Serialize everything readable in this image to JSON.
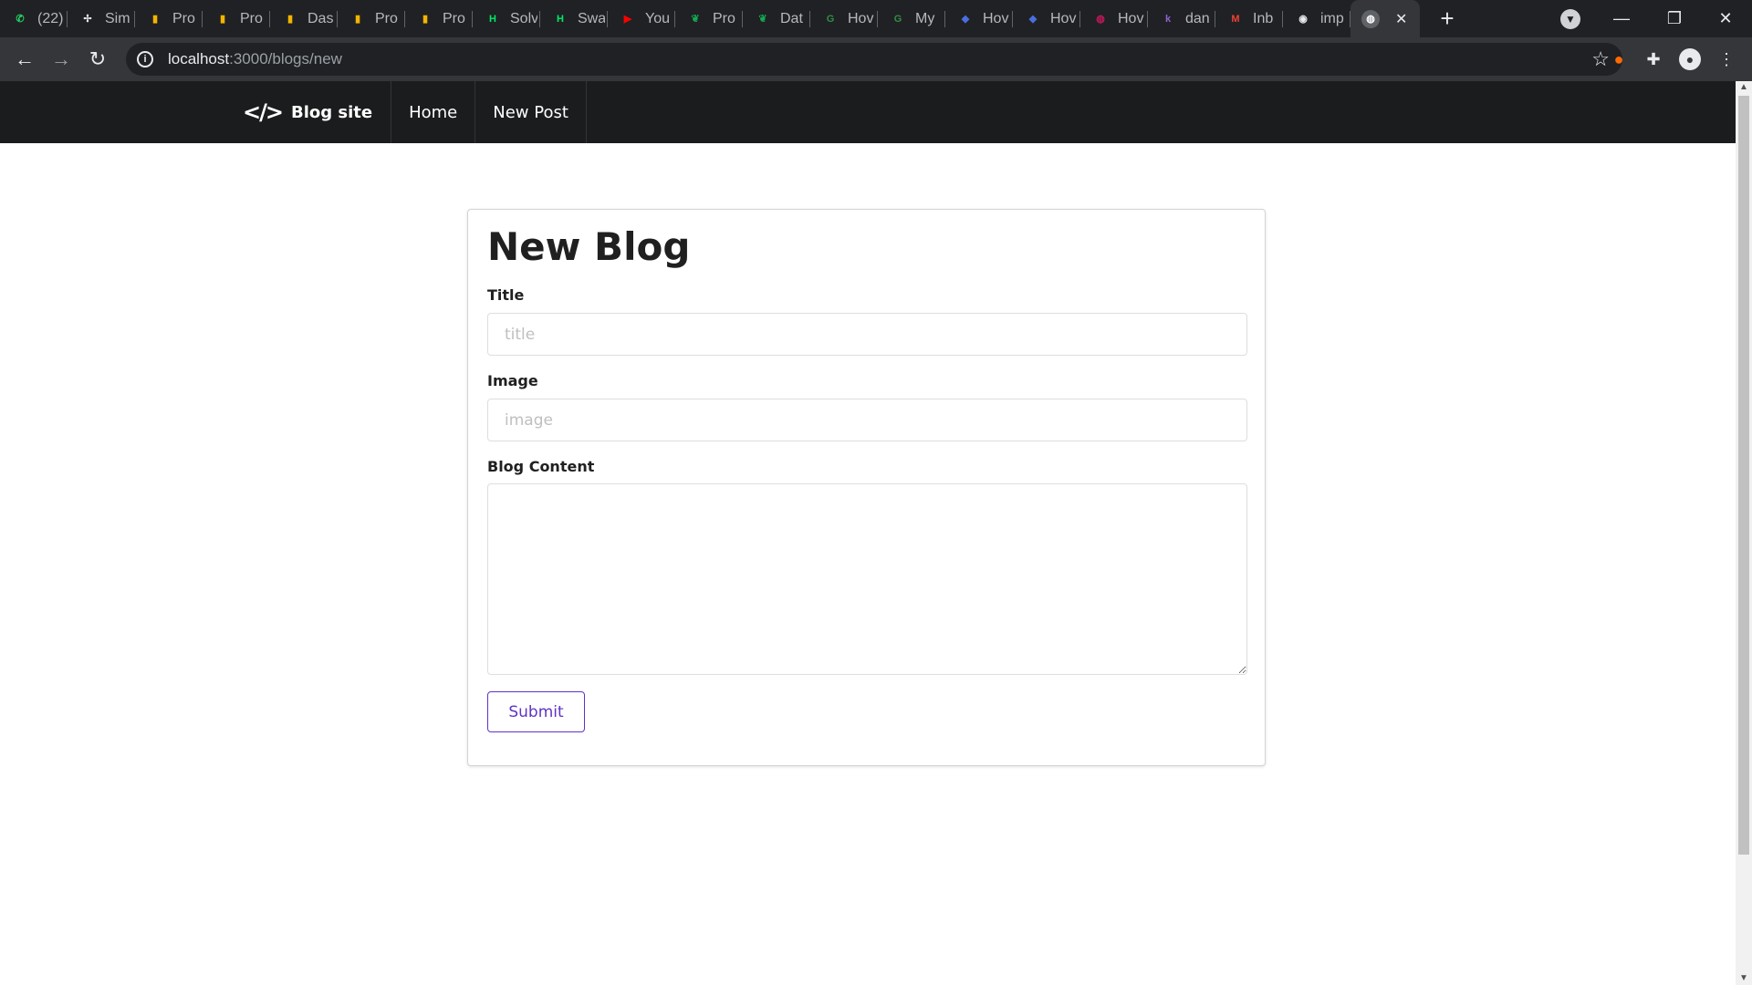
{
  "browser": {
    "tabs": [
      {
        "title": "(22)",
        "icon": "whatsapp-icon",
        "color": "#25d366"
      },
      {
        "title": "Sim",
        "icon": "pinwheel-icon",
        "color": "#e8eaed"
      },
      {
        "title": "Pro",
        "icon": "bar-chart-icon",
        "color": "#f4b400"
      },
      {
        "title": "Pro",
        "icon": "bar-chart-icon",
        "color": "#f4b400"
      },
      {
        "title": "Das",
        "icon": "bar-chart-icon",
        "color": "#f4b400"
      },
      {
        "title": "Pro",
        "icon": "bar-chart-icon",
        "color": "#f4b400"
      },
      {
        "title": "Pro",
        "icon": "bar-chart-icon",
        "color": "#f4b400"
      },
      {
        "title": "Solv",
        "icon": "hackerrank-icon",
        "color": "#00ea64"
      },
      {
        "title": "Swa",
        "icon": "hackerrank-icon",
        "color": "#00ea64"
      },
      {
        "title": "You",
        "icon": "youtube-icon",
        "color": "#ff0000"
      },
      {
        "title": "Pro",
        "icon": "mongodb-leaf-icon",
        "color": "#13aa52"
      },
      {
        "title": "Dat",
        "icon": "mongodb-leaf-icon",
        "color": "#13aa52"
      },
      {
        "title": "Hov",
        "icon": "gfg-icon",
        "color": "#2f8d46"
      },
      {
        "title": "My",
        "icon": "gfg-icon",
        "color": "#2f8d46"
      },
      {
        "title": "Hov",
        "icon": "shield-icon",
        "color": "#4a6ee0"
      },
      {
        "title": "Hov",
        "icon": "shield-icon",
        "color": "#4a6ee0"
      },
      {
        "title": "Hov",
        "icon": "globe-icon",
        "color": "#c2185b"
      },
      {
        "title": "dan",
        "icon": "k-icon",
        "color": "#8e63ce"
      },
      {
        "title": "Inb",
        "icon": "gmail-icon",
        "color": "#ea4335"
      },
      {
        "title": "imp",
        "icon": "github-icon",
        "color": "#e8eaed"
      }
    ],
    "active_tab": {
      "icon": "globe-icon",
      "close": "✕"
    },
    "new_tab": "+",
    "url_host": "localhost",
    "url_path": ":3000/blogs/new",
    "window_controls": {
      "minimize": "—",
      "restore": "❐",
      "close": "✕"
    }
  },
  "navbar": {
    "brand_icon": "</>",
    "brand": "Blog site",
    "items": [
      "Home",
      "New Post"
    ]
  },
  "form": {
    "title": "New Blog",
    "fields": [
      {
        "label": "Title",
        "placeholder": "title"
      },
      {
        "label": "Image",
        "placeholder": "image"
      }
    ],
    "content_label": "Blog Content",
    "submit": "Submit"
  },
  "colors": {
    "accent": "#5f33c6",
    "navbar_bg": "#1b1c1d",
    "chrome_bg": "#202124"
  }
}
